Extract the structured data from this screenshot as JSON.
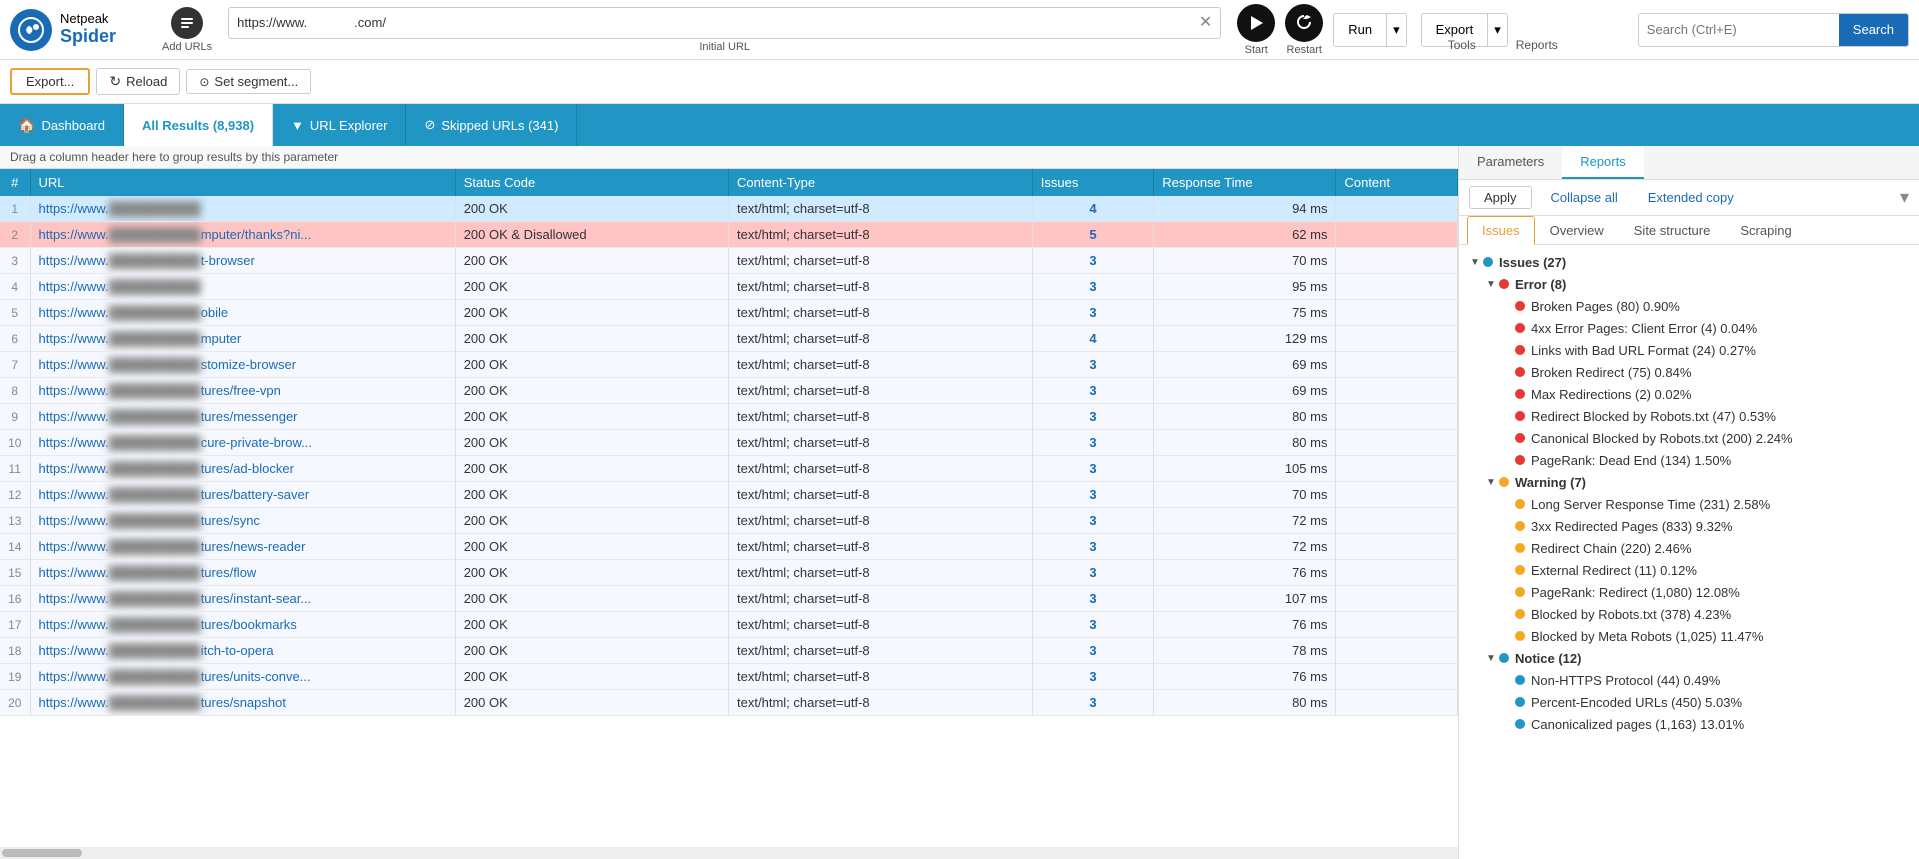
{
  "app": {
    "name": "Netpeak Spider",
    "net": "Netpeak",
    "spider": "Spider"
  },
  "topbar": {
    "url_value": "https://www.             .com/",
    "url_label": "Initial URL",
    "add_urls_label": "Add URLs",
    "start_label": "Start",
    "restart_label": "Restart",
    "tools_label": "Tools",
    "reports_label": "Reports",
    "run_label": "Run",
    "export_label": "Export",
    "search_placeholder": "Search (Ctrl+E)",
    "search_btn_label": "Search"
  },
  "toolbar": {
    "export_label": "Export...",
    "reload_label": "Reload",
    "set_segment_label": "Set segment..."
  },
  "tabs": [
    {
      "id": "dashboard",
      "label": "Dashboard",
      "icon": "🏠",
      "active": false
    },
    {
      "id": "all_results",
      "label": "All Results (8,938)",
      "active": true
    },
    {
      "id": "url_explorer",
      "label": "URL Explorer",
      "active": false
    },
    {
      "id": "skipped_urls",
      "label": "Skipped URLs (341)",
      "active": false
    }
  ],
  "table": {
    "drag_hint": "Drag a column header here to group results by this parameter",
    "columns": [
      "#",
      "URL",
      "Status Code",
      "Content-Type",
      "Issues",
      "Response Time",
      "Content"
    ],
    "rows": [
      {
        "num": "1",
        "url": "https://www.[blurred]",
        "status": "200 OK",
        "content_type": "text/html; charset=utf-8",
        "issues": "4",
        "response_time": "94 ms"
      },
      {
        "num": "2",
        "url": "https://www.[blurred]mputer/thanks?ni...",
        "status": "200 OK & Disallowed",
        "content_type": "text/html; charset=utf-8",
        "issues": "5",
        "response_time": "62 ms",
        "highlight": "red"
      },
      {
        "num": "3",
        "url": "https://www.[blurred]t-browser",
        "status": "200 OK",
        "content_type": "text/html; charset=utf-8",
        "issues": "3",
        "response_time": "70 ms"
      },
      {
        "num": "4",
        "url": "https://www.[blurred]",
        "status": "200 OK",
        "content_type": "text/html; charset=utf-8",
        "issues": "3",
        "response_time": "95 ms"
      },
      {
        "num": "5",
        "url": "https://www.[blurred]obile",
        "status": "200 OK",
        "content_type": "text/html; charset=utf-8",
        "issues": "3",
        "response_time": "75 ms"
      },
      {
        "num": "6",
        "url": "https://www.[blurred]mputer",
        "status": "200 OK",
        "content_type": "text/html; charset=utf-8",
        "issues": "4",
        "response_time": "129 ms"
      },
      {
        "num": "7",
        "url": "https://www.[blurred]stomize-browser",
        "status": "200 OK",
        "content_type": "text/html; charset=utf-8",
        "issues": "3",
        "response_time": "69 ms"
      },
      {
        "num": "8",
        "url": "https://www.[blurred]tures/free-vpn",
        "status": "200 OK",
        "content_type": "text/html; charset=utf-8",
        "issues": "3",
        "response_time": "69 ms"
      },
      {
        "num": "9",
        "url": "https://www.[blurred]tures/messenger",
        "status": "200 OK",
        "content_type": "text/html; charset=utf-8",
        "issues": "3",
        "response_time": "80 ms"
      },
      {
        "num": "10",
        "url": "https://www.[blurred]cure-private-brow...",
        "status": "200 OK",
        "content_type": "text/html; charset=utf-8",
        "issues": "3",
        "response_time": "80 ms"
      },
      {
        "num": "11",
        "url": "https://www.[blurred]tures/ad-blocker",
        "status": "200 OK",
        "content_type": "text/html; charset=utf-8",
        "issues": "3",
        "response_time": "105 ms"
      },
      {
        "num": "12",
        "url": "https://www.[blurred]tures/battery-saver",
        "status": "200 OK",
        "content_type": "text/html; charset=utf-8",
        "issues": "3",
        "response_time": "70 ms"
      },
      {
        "num": "13",
        "url": "https://www.[blurred]tures/sync",
        "status": "200 OK",
        "content_type": "text/html; charset=utf-8",
        "issues": "3",
        "response_time": "72 ms"
      },
      {
        "num": "14",
        "url": "https://www.[blurred]tures/news-reader",
        "status": "200 OK",
        "content_type": "text/html; charset=utf-8",
        "issues": "3",
        "response_time": "72 ms"
      },
      {
        "num": "15",
        "url": "https://www.[blurred]tures/flow",
        "status": "200 OK",
        "content_type": "text/html; charset=utf-8",
        "issues": "3",
        "response_time": "76 ms"
      },
      {
        "num": "16",
        "url": "https://www.[blurred]tures/instant-sear...",
        "status": "200 OK",
        "content_type": "text/html; charset=utf-8",
        "issues": "3",
        "response_time": "107 ms"
      },
      {
        "num": "17",
        "url": "https://www.[blurred]tures/bookmarks",
        "status": "200 OK",
        "content_type": "text/html; charset=utf-8",
        "issues": "3",
        "response_time": "76 ms"
      },
      {
        "num": "18",
        "url": "https://www.[blurred]itch-to-opera",
        "status": "200 OK",
        "content_type": "text/html; charset=utf-8",
        "issues": "3",
        "response_time": "78 ms"
      },
      {
        "num": "19",
        "url": "https://www.[blurred]tures/units-conve...",
        "status": "200 OK",
        "content_type": "text/html; charset=utf-8",
        "issues": "3",
        "response_time": "76 ms"
      },
      {
        "num": "20",
        "url": "https://www.[blurred]tures/snapshot",
        "status": "200 OK",
        "content_type": "text/html; charset=utf-8",
        "issues": "3",
        "response_time": "80 ms"
      }
    ]
  },
  "right_panel": {
    "tabs": [
      "Parameters",
      "Reports"
    ],
    "active_tab": "Reports",
    "toolbar": {
      "apply_label": "Apply",
      "collapse_all_label": "Collapse all",
      "extended_copy_label": "Extended copy"
    },
    "sub_tabs": [
      "Issues",
      "Overview",
      "Site structure",
      "Scraping"
    ],
    "active_sub_tab": "Issues",
    "issues_tree": {
      "root": {
        "label": "Issues (27)",
        "expanded": true,
        "children": [
          {
            "label": "Error (8)",
            "type": "error",
            "expanded": true,
            "children": [
              {
                "label": "Broken Pages (80) 0.90%"
              },
              {
                "label": "4xx Error Pages: Client Error (4) 0.04%"
              },
              {
                "label": "Links with Bad URL Format (24) 0.27%"
              },
              {
                "label": "Broken Redirect (75) 0.84%"
              },
              {
                "label": "Max Redirections (2) 0.02%"
              },
              {
                "label": "Redirect Blocked by Robots.txt (47) 0.53%"
              },
              {
                "label": "Canonical Blocked by Robots.txt (200) 2.24%"
              },
              {
                "label": "PageRank: Dead End (134) 1.50%"
              }
            ]
          },
          {
            "label": "Warning (7)",
            "type": "warning",
            "expanded": true,
            "children": [
              {
                "label": "Long Server Response Time (231) 2.58%"
              },
              {
                "label": "3xx Redirected Pages (833) 9.32%"
              },
              {
                "label": "Redirect Chain (220) 2.46%"
              },
              {
                "label": "External Redirect (11) 0.12%"
              },
              {
                "label": "PageRank: Redirect (1,080) 12.08%"
              },
              {
                "label": "Blocked by Robots.txt (378) 4.23%"
              },
              {
                "label": "Blocked by Meta Robots (1,025) 11.47%"
              }
            ]
          },
          {
            "label": "Notice (12)",
            "type": "notice",
            "expanded": true,
            "children": [
              {
                "label": "Non-HTTPS Protocol (44) 0.49%"
              },
              {
                "label": "Percent-Encoded URLs (450) 5.03%"
              },
              {
                "label": "Canonicalized pages (1,163) 13.01%"
              }
            ]
          }
        ]
      }
    }
  }
}
